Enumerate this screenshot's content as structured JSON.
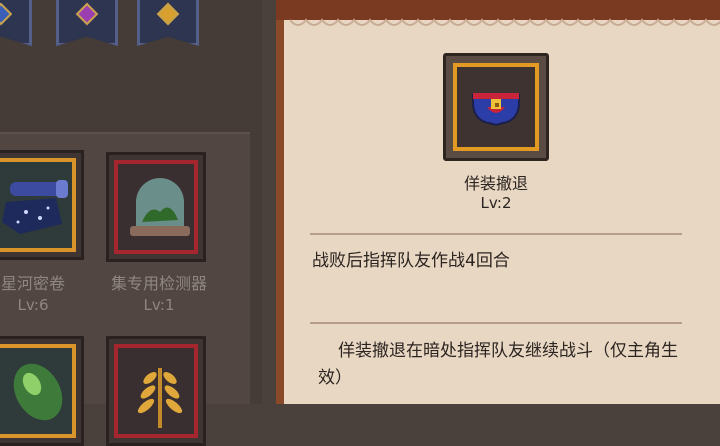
{
  "item": {
    "name": "佯装撤退",
    "level": "Lv:2",
    "effect": "战败后指挥队友作战4回合",
    "description": "佯装撤退在暗处指挥队友继续战斗（仅主角生效）"
  },
  "inventory": [
    {
      "name": "星河密卷",
      "level": "Lv:6",
      "icon": "scroll-icon"
    },
    {
      "name": "集专用检测器",
      "level": "Lv:1",
      "icon": "terrarium-icon"
    },
    {
      "name": "",
      "level": "",
      "icon": "beetle-icon"
    },
    {
      "name": "",
      "level": "",
      "icon": "wheat-icon"
    }
  ],
  "banners": [
    {
      "gem_color": "#3a5fb8",
      "icon": "blue-gem-icon"
    },
    {
      "gem_color": "#9b3fb0",
      "icon": "purple-gem-icon"
    },
    {
      "gem_color": "#d9a030",
      "icon": "gold-gem-icon"
    }
  ]
}
